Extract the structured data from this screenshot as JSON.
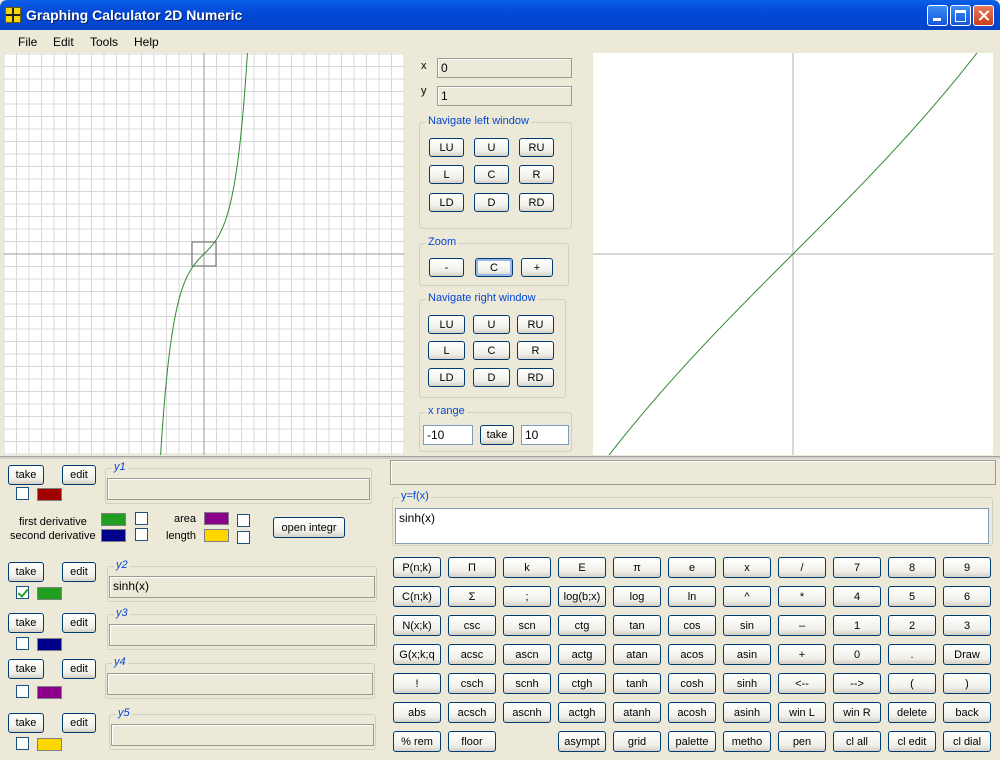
{
  "window": {
    "title": "Graphing Calculator  2D Numeric"
  },
  "menu": [
    "File",
    "Edit",
    "Tools",
    "Help"
  ],
  "coords": {
    "x_label": "x",
    "x_value": "0",
    "y_label": "y",
    "y_value": "1"
  },
  "nav_left": {
    "title": "Navigate left window",
    "buttons": [
      "LU",
      "U",
      "RU",
      "L",
      "C",
      "R",
      "LD",
      "D",
      "RD"
    ]
  },
  "zoom": {
    "title": "Zoom",
    "buttons": [
      "-",
      "C",
      "+"
    ]
  },
  "nav_right": {
    "title": "Navigate right window",
    "buttons": [
      "LU",
      "U",
      "RU",
      "L",
      "C",
      "R",
      "LD",
      "D",
      "RD"
    ]
  },
  "xrange": {
    "title": "x range",
    "min": "-10",
    "take_label": "take",
    "max": "10"
  },
  "functions": {
    "take_label": "take",
    "edit_label": "edit",
    "slots": [
      {
        "name": "y1",
        "expr": "",
        "checked": false,
        "color": "#A00000"
      },
      {
        "name": "y2",
        "expr": "sinh(x)",
        "checked": true,
        "color": "#1F9E1F"
      },
      {
        "name": "y3",
        "expr": "",
        "checked": false,
        "color": "#00008B"
      },
      {
        "name": "y4",
        "expr": "",
        "checked": false,
        "color": "#8B008B"
      },
      {
        "name": "y5",
        "expr": "",
        "checked": false,
        "color": "#FFD700"
      }
    ]
  },
  "derivatives": {
    "first_label": "first derivative",
    "first_color": "#1F9E1F",
    "second_label": "second derivative",
    "second_color": "#00008B",
    "area_label": "area",
    "area_color": "#8B008B",
    "length_label": "length",
    "length_color": "#FFD700",
    "open_integr_label": "open integr"
  },
  "editor": {
    "group_title": "y=f(x)",
    "expr": "sinh(x)",
    "status": ""
  },
  "keypad": [
    [
      "P(n;k)",
      "Π",
      "k",
      "E",
      "π",
      "e",
      "x",
      "/",
      "7",
      "8",
      "9"
    ],
    [
      "C(n;k)",
      "Σ",
      ";",
      "log(b;x)",
      "log",
      "ln",
      "^",
      "*",
      "4",
      "5",
      "6"
    ],
    [
      "N(x;k)",
      "csc",
      "scn",
      "ctg",
      "tan",
      "cos",
      "sin",
      "–",
      "1",
      "2",
      "3"
    ],
    [
      "G(x;k;q",
      "acsc",
      "ascn",
      "actg",
      "atan",
      "acos",
      "asin",
      "+",
      "0",
      ".",
      "Draw"
    ],
    [
      "!",
      "csch",
      "scnh",
      "ctgh",
      "tanh",
      "cosh",
      "sinh",
      "<--",
      "-->",
      "(",
      ")"
    ],
    [
      "abs",
      "acsch",
      "ascnh",
      "actgh",
      "atanh",
      "acosh",
      "asinh",
      "win L",
      "win R",
      "delete",
      "back"
    ],
    [
      "% rem",
      "floor",
      "",
      "asympt",
      "grid",
      "palette",
      "metho",
      "pen",
      "cl all",
      "cl edit",
      "cl dial"
    ]
  ]
}
